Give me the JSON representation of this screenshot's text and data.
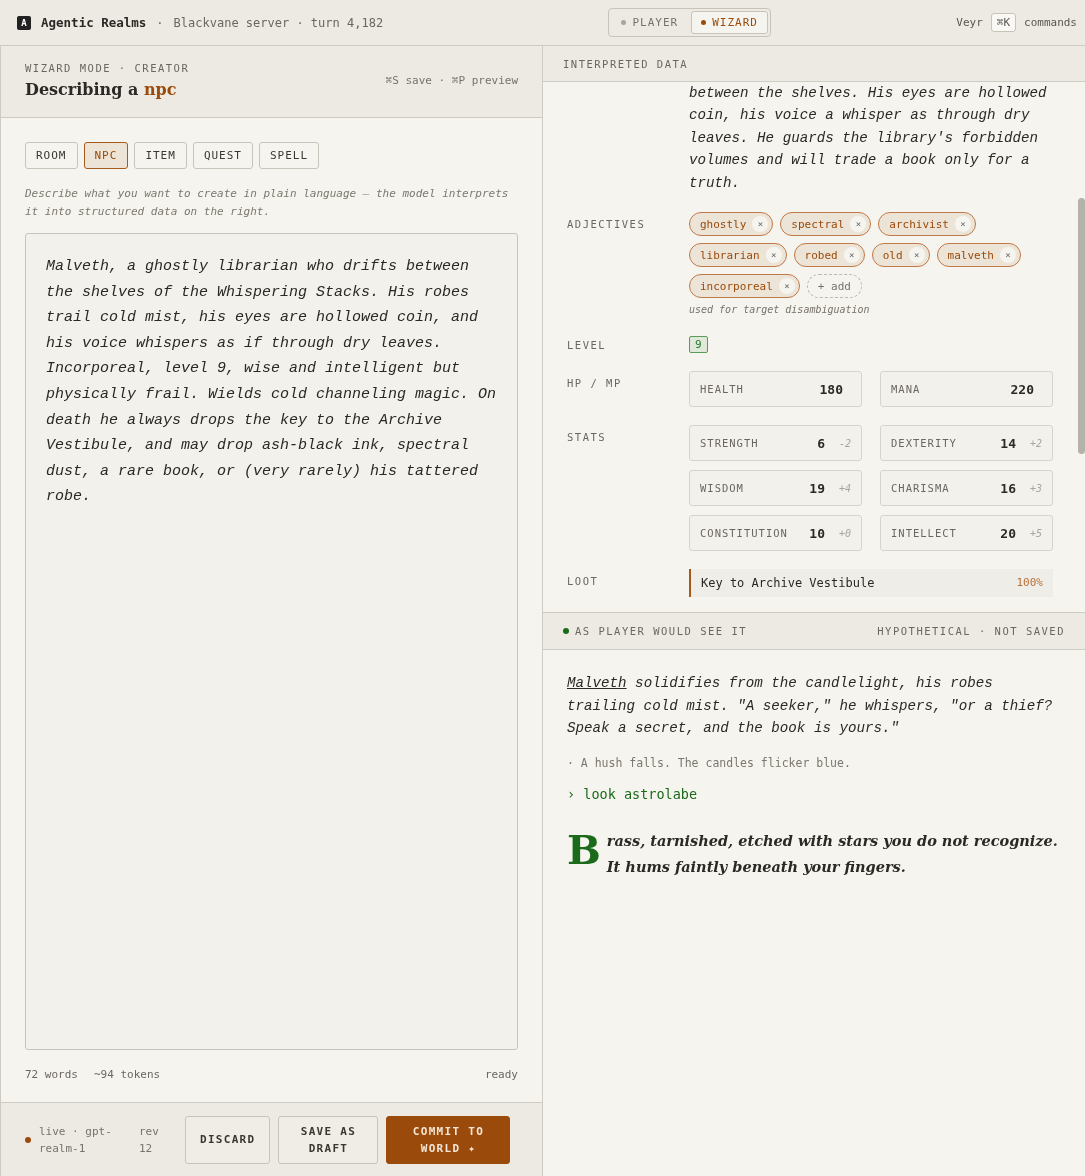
{
  "topbar": {
    "app_badge": "A",
    "app_name": "Agentic Realms",
    "separator": "·",
    "server": "Blackvane server · turn 4,182",
    "modes": [
      {
        "label": "PLAYER",
        "selected": false
      },
      {
        "label": "WIZARD",
        "selected": true
      }
    ],
    "user": "Veyr",
    "shortcut": "⌘K",
    "shortcut_label": "commands"
  },
  "editor": {
    "eyebrow": "WIZARD MODE · CREATOR",
    "title": "Describing a **npc**",
    "hotkeys": "⌘S save · ⌘P preview",
    "types": [
      {
        "label": "ROOM",
        "selected": false
      },
      {
        "label": "NPC",
        "selected": true
      },
      {
        "label": "ITEM",
        "selected": false
      },
      {
        "label": "QUEST",
        "selected": false
      },
      {
        "label": "SPELL",
        "selected": false
      }
    ],
    "hint": "Describe what you want to create in plain language — the model interprets it into structured data on the right.",
    "description": "Malveth, a ghostly librarian who drifts between the shelves of the Whispering Stacks. His robes trail cold mist, his eyes are hollowed coin, and his voice whispers as if through dry leaves. Incorporeal, level 9, wise and intelligent but physically frail. Wields cold channeling magic. On death he always drops the key to the Archive Vestibule, and may drop ash-black ink, spectral dust, a rare book, or (very rarely) his tattered robe.",
    "words": "72 words",
    "tokens": "~94 tokens",
    "status": "ready"
  },
  "footer": {
    "model": "live · gpt-realm-1",
    "rev": "rev 12",
    "buttons": [
      {
        "label": "DISCARD",
        "kind": "secondary"
      },
      {
        "label": "SAVE AS DRAFT",
        "kind": "secondary"
      },
      {
        "label": "COMMIT TO WORLD ✦",
        "kind": "primary"
      }
    ]
  },
  "interpreted": {
    "header": "INTERPRETED DATA",
    "summary": "between the shelves. His eyes are hollowed coin, his voice a whisper as through dry leaves. He guards the library's forbidden volumes and will trade a book only for a truth.",
    "adjectives_label": "ADJECTIVES",
    "adjectives": [
      "ghostly",
      "spectral",
      "archivist",
      "librarian",
      "robed",
      "old",
      "malveth",
      "incorporeal"
    ],
    "remove_glyph": "×",
    "add_label": "+ add",
    "adjectives_note": "used for target disambiguation",
    "level_label": "LEVEL",
    "level": "9",
    "hpmp_label": "HP / MP",
    "pools": [
      {
        "name": "HEALTH",
        "value": "180"
      },
      {
        "name": "MANA",
        "value": "220"
      }
    ],
    "stats_label": "STATS",
    "stats": [
      {
        "name": "STRENGTH",
        "value": "6",
        "mod": "-2"
      },
      {
        "name": "DEXTERITY",
        "value": "14",
        "mod": "+2"
      },
      {
        "name": "WISDOM",
        "value": "19",
        "mod": "+4"
      },
      {
        "name": "CHARISMA",
        "value": "16",
        "mod": "+3"
      },
      {
        "name": "CONSTITUTION",
        "value": "10",
        "mod": "+0"
      },
      {
        "name": "INTELLECT",
        "value": "20",
        "mod": "+5"
      }
    ],
    "loot_label": "LOOT",
    "loot": [
      {
        "name": "Key to Archive Vestibule",
        "chance": "100%"
      }
    ]
  },
  "preview": {
    "header": "AS PLAYER WOULD SEE IT",
    "note": "HYPOTHETICAL · NOT SAVED",
    "npc_name": "Malveth",
    "speech": "solidifies from the candlelight, his robes trailing cold mist. \"A seeker,\" he whispers, \"or a thief? Speak a secret, and the book is yours.\"",
    "ambient": "· A hush falls. The candles flicker blue.",
    "command": "› look astrolabe",
    "drop_cap": "B",
    "narration": "rass, tarnished, etched with stars you do not recognize. It hums faintly beneath your fingers."
  }
}
